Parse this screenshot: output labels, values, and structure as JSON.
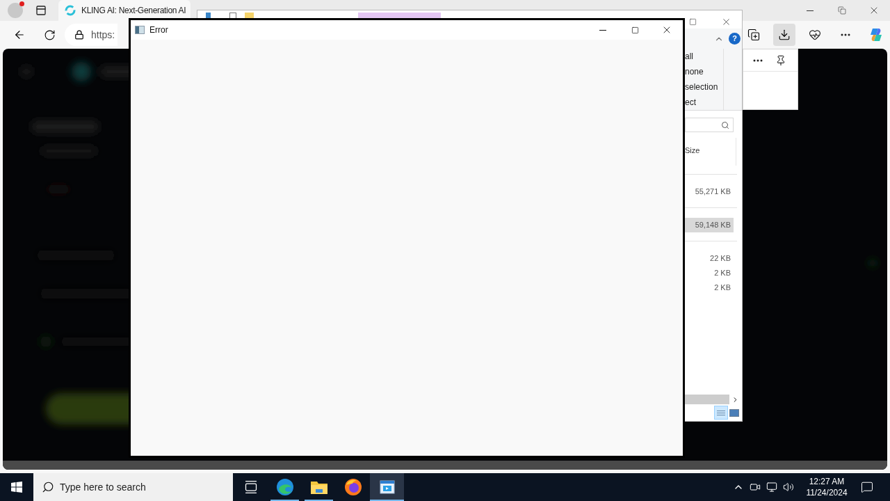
{
  "browser": {
    "tab": {
      "title": "KLING AI: Next-Generation AI"
    },
    "address": "https:",
    "toolbar_buttons": [
      {
        "kind": "collections",
        "selected": false
      },
      {
        "kind": "downloads",
        "selected": true
      },
      {
        "kind": "health",
        "selected": false
      },
      {
        "kind": "more",
        "selected": false
      },
      {
        "kind": "copilot",
        "selected": false
      }
    ]
  },
  "explorer": {
    "help_label": "?",
    "ribbon_items": [
      "all",
      "none",
      "selection",
      "ect"
    ],
    "columns": [
      "Size"
    ],
    "groups": [
      {
        "rows": [
          {
            "size": "55,271 KB",
            "selected": false
          }
        ]
      },
      {
        "rows": [
          {
            "size": "59,148 KB",
            "selected": true
          }
        ]
      },
      {
        "rows": [
          {
            "size": "22 KB",
            "selected": false
          },
          {
            "size": "2 KB",
            "selected": false
          },
          {
            "size": "2 KB",
            "selected": false
          }
        ]
      }
    ]
  },
  "error_window": {
    "title": "Error"
  },
  "taskbar": {
    "search_placeholder": "Type here to search",
    "apps": [
      {
        "kind": "task-view",
        "selected": false,
        "running": false
      },
      {
        "kind": "edge",
        "selected": false,
        "running": true
      },
      {
        "kind": "explorer",
        "selected": false,
        "running": true
      },
      {
        "kind": "firefox",
        "selected": false,
        "running": false
      },
      {
        "kind": "app",
        "selected": true,
        "running": true
      }
    ],
    "clock": {
      "time": "12:27 AM",
      "date": "11/24/2024"
    }
  }
}
